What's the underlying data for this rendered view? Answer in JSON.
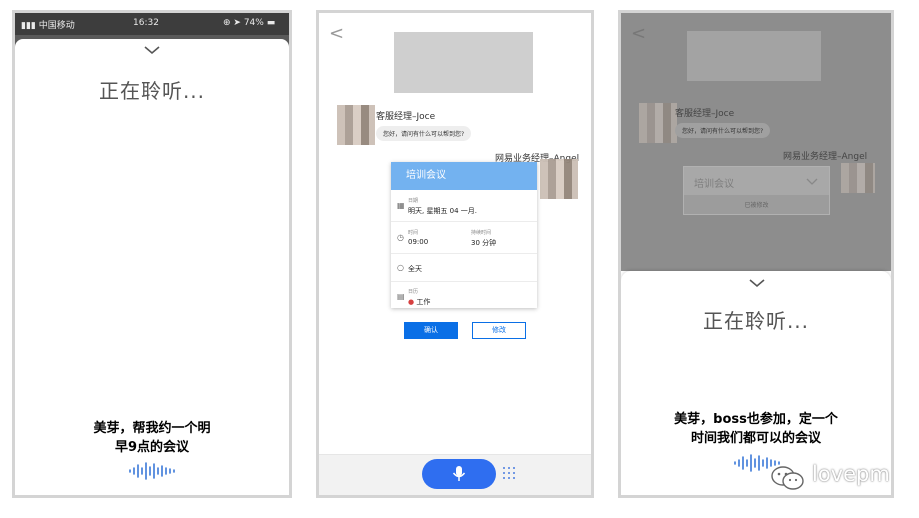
{
  "screen1": {
    "status": {
      "carrier": "中国移动",
      "time": "16:32",
      "battery": "74%"
    },
    "listening_text": "正在聆听...",
    "utterance_line1": "美芽，帮我约一个明",
    "utterance_line2": "早9点的会议"
  },
  "screen2": {
    "back_glyph": "<",
    "agent_name": "客服经理–Joce",
    "agent_greeting": "您好，请问有什么可以帮到您?",
    "user_name": "网易业务经理–Angel",
    "card": {
      "title": "培训会议",
      "date_label": "日期",
      "date_value": "明天, 星期五 04 一月.",
      "time_label": "时间",
      "time_value": "09:00",
      "duration_label": "持续时间",
      "duration_value": "30 分钟",
      "allday_value": "全天",
      "calendar_label": "日历",
      "calendar_value": "工作"
    },
    "confirm_label": "确认",
    "modify_label": "修改"
  },
  "screen3": {
    "back_glyph": "<",
    "agent_name": "客服经理–Joce",
    "agent_greeting": "您好，请问有什么可以帮到您?",
    "user_name": "网易业务经理–Angel",
    "collapsed_card_title": "培训会议",
    "collapsed_card_status": "已被修改",
    "listening_text": "正在聆听...",
    "utterance_line1": "美芽，boss也参加，定一个",
    "utterance_line2": "时间我们都可以的会议"
  },
  "watermark": "lovepm",
  "colors": {
    "accent": "#2f6ef0",
    "card_header": "#73b2f0",
    "wave": "#3a78d8"
  }
}
